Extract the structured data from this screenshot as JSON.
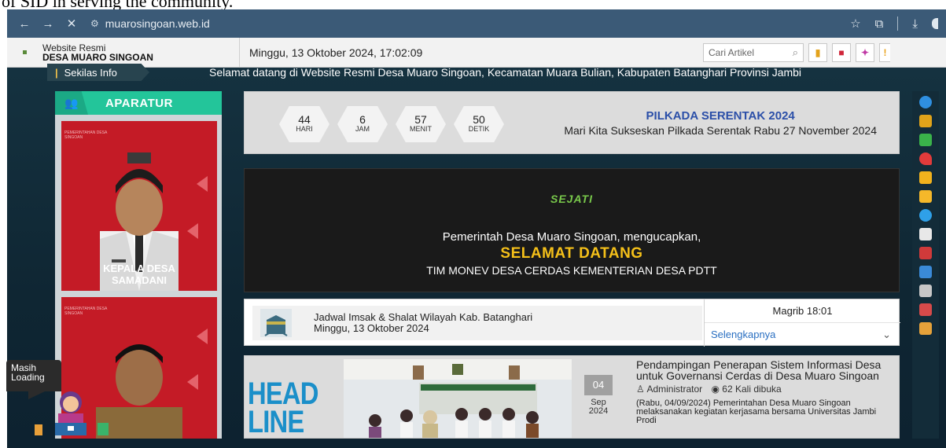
{
  "caption": "of SID in serving the community.",
  "browser": {
    "url": "muarosingoan.web.id",
    "icons": [
      "back-arrow",
      "forward-arrow",
      "close",
      "site-tune",
      "star",
      "extensions",
      "download"
    ]
  },
  "site": {
    "brand_line1": "Website Resmi",
    "brand_line2": "DESA MUARO SINGOAN",
    "datetime": "Minggu, 13 Oktober 2024, 17:02:09",
    "search_placeholder": "Cari Artikel"
  },
  "ticker": {
    "label": "Sekilas Info",
    "message": "Selamat datang di Website Resmi Desa Muaro Singoan, Kecamatan Muara Bulian, Kabupaten Batanghari Provinsi Jambi"
  },
  "sidebar": {
    "title": "APARATUR",
    "officials": [
      {
        "name_line1": "KEPALA DESA",
        "name_line2": "SAMADANI"
      }
    ]
  },
  "countdown": {
    "days": "44",
    "days_label": "HARI",
    "hours": "6",
    "hours_label": "JAM",
    "minutes": "57",
    "minutes_label": "MENIT",
    "seconds": "50",
    "seconds_label": "DETIK",
    "title": "PILKADA SERENTAK 2024",
    "subtitle": "Mari Kita Sukseskan Pilkada Serentak Rabu 27 November 2024"
  },
  "banner": {
    "logo_text": "SEJATI",
    "line1": "Pemerintah Desa Muaro Singoan, mengucapkan,",
    "line2": "SELAMAT DATANG",
    "line3": "TIM MONEV DESA CERDAS KEMENTERIAN DESA PDTT"
  },
  "prayer": {
    "title": "Jadwal Imsak & Shalat Wilayah Kab. Batanghari",
    "date": "Minggu, 13 Oktober 2024",
    "next": "Magrib 18:01",
    "more": "Selengkapnya"
  },
  "headline": {
    "word1": "HEAD",
    "word2": "LINE",
    "day": "04",
    "month": "Sep",
    "year": "2024",
    "title": "Pendampingan Penerapan Sistem Informasi Desa untuk Governansi Cerdas di Desa Muaro Singoan",
    "author": "Administrator",
    "views": "62 Kali dibuka",
    "excerpt": "(Rabu, 04/09/2024) Pemerintahan Desa Muaro Singoan melaksanakan kegiatan kerjasama bersama Universitas Jambi Prodi"
  },
  "loading": {
    "line1": "Masih",
    "line2": "Loading"
  },
  "colors": {
    "accent_green": "#23c59a",
    "aparatur_red": "#c41b26",
    "headline_blue": "#1b8fc9",
    "banner_gold": "#f5c019",
    "pilkada_blue": "#2b4fa8"
  }
}
